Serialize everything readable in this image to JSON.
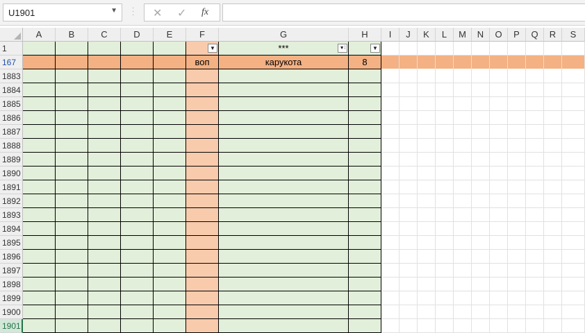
{
  "name_box": {
    "value": "U1901"
  },
  "formula_bar": {
    "cancel_icon": "✕",
    "enter_icon": "✓",
    "fx_label": "fx",
    "value": ""
  },
  "columns": [
    "A",
    "B",
    "C",
    "D",
    "E",
    "F",
    "G",
    "H",
    "I",
    "J",
    "K",
    "L",
    "M",
    "N",
    "O",
    "P",
    "Q",
    "R",
    "S"
  ],
  "header_row": {
    "number": "1",
    "g_text": "***"
  },
  "highlight_row": {
    "number": "167",
    "f": "воп",
    "g": "карукота",
    "h": "8"
  },
  "rows": [
    "1883",
    "1884",
    "1885",
    "1886",
    "1887",
    "1888",
    "1889",
    "1890",
    "1891",
    "1892",
    "1893",
    "1894",
    "1895",
    "1896",
    "1897",
    "1898",
    "1899",
    "1900",
    "1901"
  ],
  "colors": {
    "green_fill": "#e2efda",
    "orange_fill": "#f4b183",
    "peach_fill": "#f8cbad",
    "row_number_blue": "#1f4fa8"
  },
  "icons": {
    "filter": "filter-dropdown-icon",
    "filter_active": "filter-applied-icon"
  }
}
